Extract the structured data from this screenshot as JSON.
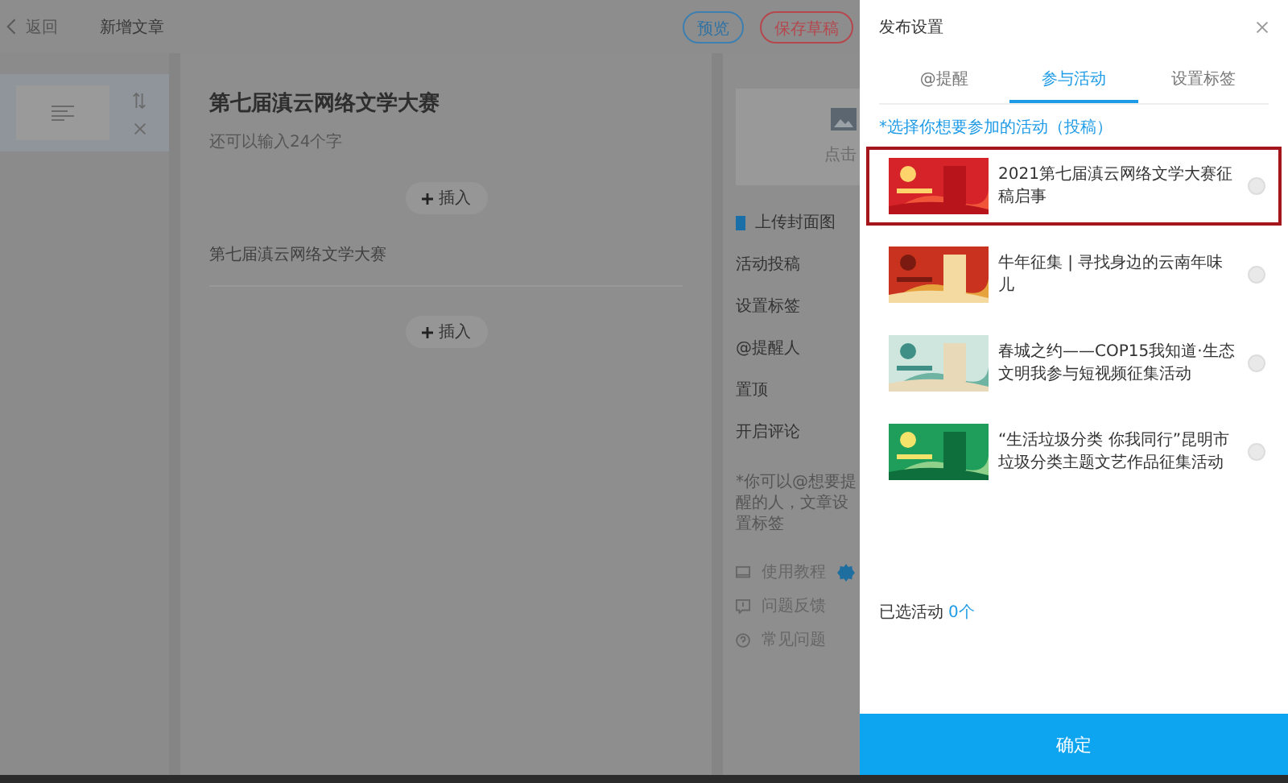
{
  "page": {
    "back_link": "返回",
    "title": "新增文章",
    "preview_button": "预览",
    "save_draft_button": "保存草稿",
    "article_title": "第七届滇云网络文学大赛",
    "title_hint": "还可以输入24个字",
    "insert_buttons": [
      "插入",
      "插入"
    ],
    "paragraph": "第七届滇云网络文学大赛",
    "cover_hint": "点击",
    "upload_cover": "上传封面图",
    "settings": [
      "活动投稿",
      "设置标签",
      "@提醒人",
      "置顶",
      "开启评论"
    ],
    "note": "*你可以@想要提醒的人，文章设置标签",
    "help_links": [
      {
        "kind": "tutorial",
        "label": "使用教程",
        "new_badge": true
      },
      {
        "kind": "feedback",
        "label": "问题反馈",
        "new_badge": false
      },
      {
        "kind": "faq",
        "label": "常见问题",
        "new_badge": false
      }
    ]
  },
  "drawer": {
    "title": "发布设置",
    "tabs": [
      {
        "label": "@提醒",
        "selected": false
      },
      {
        "label": "参与活动",
        "selected": true
      },
      {
        "label": "设置标签",
        "selected": false
      }
    ],
    "hint": "*选择你想要参加的活动（投稿）",
    "activities": [
      {
        "title": "2021第七届滇云网络文学大赛征稿启事",
        "highlighted": true,
        "selected": false
      },
      {
        "title": "牛年征集 | 寻找身边的云南年味儿",
        "highlighted": false,
        "selected": false
      },
      {
        "title": "春城之约——COP15我知道·生态文明我参与短视频征集活动",
        "highlighted": false,
        "selected": false
      },
      {
        "title": "“生活垃圾分类 你我同行”昆明市垃圾分类主题文艺作品征集活动",
        "highlighted": false,
        "selected": false
      }
    ],
    "selected_label": "已选活动",
    "selected_count": "0个",
    "confirm_button": "确定"
  }
}
